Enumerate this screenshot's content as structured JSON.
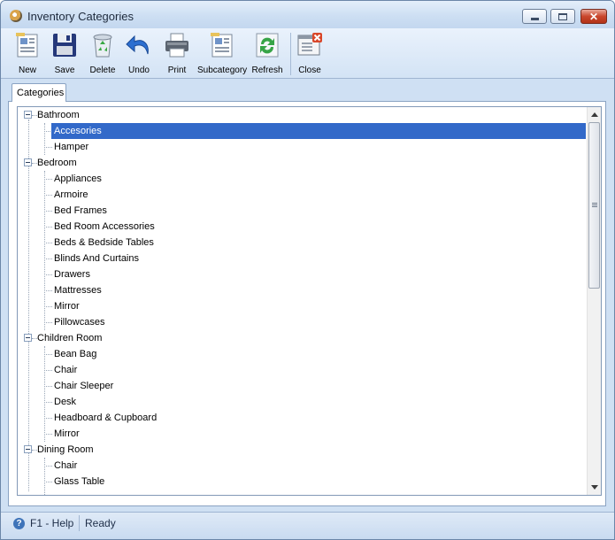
{
  "window": {
    "title": "Inventory Categories"
  },
  "toolbar": {
    "new": "New",
    "save": "Save",
    "delete": "Delete",
    "undo": "Undo",
    "print": "Print",
    "subcategory": "Subcategory",
    "refresh": "Refresh",
    "close": "Close"
  },
  "tabs": {
    "categories": "Categories"
  },
  "tree": {
    "bathroom": "Bathroom",
    "accesories": "Accesories",
    "hamper": "Hamper",
    "bedroom": "Bedroom",
    "appliances": "Appliances",
    "armoire": "Armoire",
    "bed_frames": "Bed Frames",
    "bed_room_accessories": "Bed Room Accessories",
    "beds_bedside_tables": "Beds & Bedside Tables",
    "blinds_curtains": "Blinds And Curtains",
    "drawers": "Drawers",
    "mattresses": "Mattresses",
    "mirror_bedroom": "Mirror",
    "pillowcases": "Pillowcases",
    "children_room": "Children Room",
    "bean_bag": "Bean Bag",
    "chair_children": "Chair",
    "chair_sleeper": "Chair Sleeper",
    "desk": "Desk",
    "headboard_cupboard": "Headboard & Cupboard",
    "mirror_children": "Mirror",
    "dining_room": "Dining Room",
    "chair_dining": "Chair",
    "glass_table": "Glass Table",
    "selected": "Accesories"
  },
  "status": {
    "help": "F1 - Help",
    "state": "Ready"
  }
}
